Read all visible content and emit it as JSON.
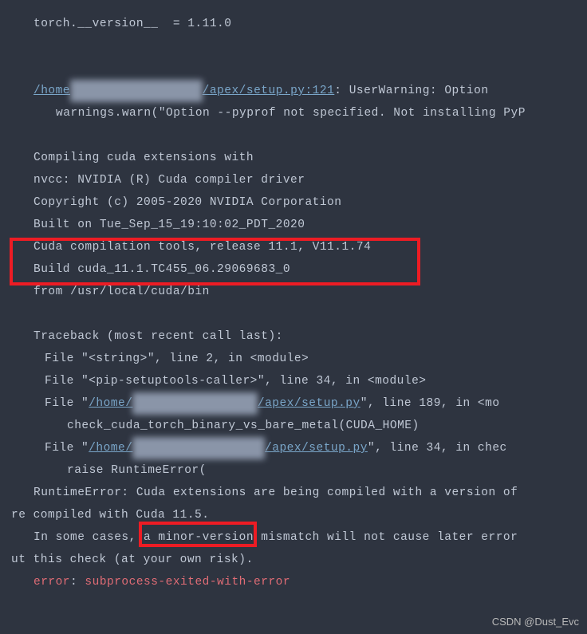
{
  "lines": {
    "l1": "torch.__version__  = 1.11.0",
    "l2_a": "/home",
    "l2_blur": "xxxxxxxxxxxxxxxxxx",
    "l2_b": "/apex/setup.py:121",
    "l2_c": ": UserWarning: Option ",
    "l3": "warnings.warn(\"Option --pyprof not specified. Not installing PyP",
    "l4": "Compiling cuda extensions with",
    "l5": "nvcc: NVIDIA (R) Cuda compiler driver",
    "l6": "Copyright (c) 2005-2020 NVIDIA Corporation",
    "l7": "Built on Tue_Sep_15_19:10:02_PDT_2020",
    "l8": "Cuda compilation tools, release 11.1, V11.1.74",
    "l9": "Build cuda_11.1.TC455_06.29069683_0",
    "l10": "from /usr/local/cuda/bin",
    "l11": "Traceback (most recent call last):",
    "l12": "File \"<string>\", line 2, in <module>",
    "l13": "File \"<pip-setuptools-caller>\", line 34, in <module>",
    "l14a": "File \"",
    "l14b": "/home/",
    "l14blur": "xxxxxxxxxxxxxxxxx",
    "l14c": "/apex/setup.py",
    "l14d": "\", line 189, in <mo",
    "l15": "check_cuda_torch_binary_vs_bare_metal(CUDA_HOME)",
    "l16a": "File \"",
    "l16b": "/home/",
    "l16blur": "xxxxxxxxxxxxxxxxxx",
    "l16c": "/apex/setup.py",
    "l16d": "\", line 34, in chec",
    "l17": "raise RuntimeError(",
    "l18": "RuntimeError: Cuda extensions are being compiled with a version of",
    "l19": "re compiled with Cuda 11.5.",
    "l20": "In some cases, a minor-version mismatch will not cause later error",
    "l21": "ut this check (at your own risk).",
    "l22a": "error",
    "l22b": ": ",
    "l22c": "subprocess-exited-with-error"
  },
  "watermark": "CSDN @Dust_Evc"
}
